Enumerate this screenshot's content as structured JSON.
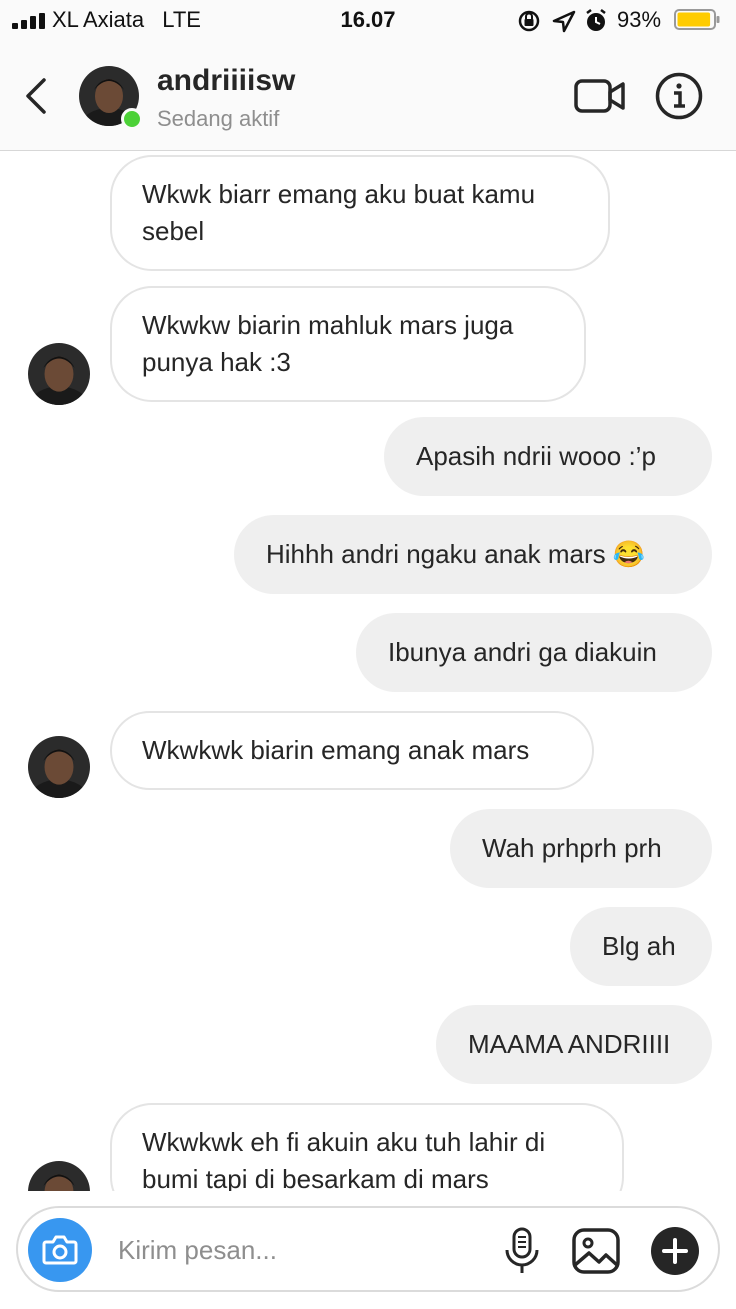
{
  "status_bar": {
    "carrier": "XL Axiata",
    "network": "LTE",
    "time": "16.07",
    "battery_percent": "93%",
    "battery_level": 0.93,
    "battery_color": "#ffcc00"
  },
  "header": {
    "back_icon": "chevron-left-icon",
    "username": "andriiiisw",
    "activity": "Sedang aktif",
    "online_color": "#4cd137",
    "video_icon": "video-camera-icon",
    "info_icon": "info-icon"
  },
  "messages": [
    {
      "direction": "incoming",
      "avatar": false,
      "lines": [
        "Wkwk biarr emang aku buat kamu",
        "sebel"
      ]
    },
    {
      "direction": "incoming",
      "avatar": true,
      "lines": [
        "Wkwkw biarin mahluk mars juga",
        "punya hak :3"
      ]
    },
    {
      "direction": "outgoing",
      "lines": [
        "Apasih ndrii wooo :’p"
      ]
    },
    {
      "direction": "outgoing",
      "lines": [
        "Hihhh andri ngaku anak mars 😂"
      ]
    },
    {
      "direction": "outgoing",
      "lines": [
        "Ibunya andri ga diakuin"
      ]
    },
    {
      "direction": "incoming",
      "avatar": true,
      "lines": [
        "Wkwkwk biarin emang anak mars"
      ]
    },
    {
      "direction": "outgoing",
      "lines": [
        "Wah prhprh prh"
      ]
    },
    {
      "direction": "outgoing",
      "lines": [
        "Blg ah"
      ]
    },
    {
      "direction": "outgoing",
      "lines": [
        "MAAMA ANDRIIII"
      ]
    },
    {
      "direction": "incoming",
      "avatar": true,
      "lines": [
        "Wkwkwk eh fi akuin aku tuh lahir di",
        "bumi tapi di besarkam di mars"
      ]
    }
  ],
  "composer": {
    "placeholder": "Kirim pesan...",
    "camera_icon": "camera-icon",
    "mic_icon": "microphone-icon",
    "gallery_icon": "image-icon",
    "plus_icon": "plus-icon",
    "accent_color": "#3897f0"
  }
}
